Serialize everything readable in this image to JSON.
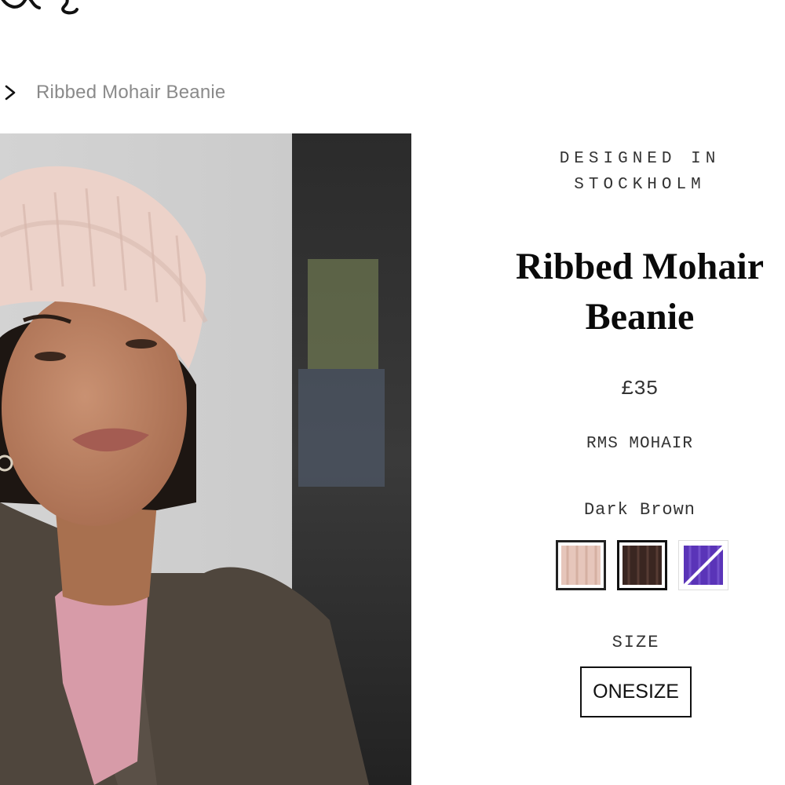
{
  "breadcrumb": {
    "current": "Ribbed Mohair Beanie"
  },
  "product": {
    "tagline_line1": "DESIGNED IN",
    "tagline_line2": "STOCKHOLM",
    "title_line1": "Ribbed Mohair",
    "title_line2": "Beanie",
    "price": "£35",
    "material": "RMS MOHAIR",
    "selected_color": "Dark Brown",
    "size_label": "SIZE",
    "size_option": "ONESIZE"
  },
  "swatches": [
    {
      "name": "light-pink",
      "color": "#e6c6bb",
      "state": "selected"
    },
    {
      "name": "dark-brown",
      "color": "#3a2621",
      "state": "normal"
    },
    {
      "name": "purple",
      "color": "#5a34b8",
      "state": "unavailable"
    }
  ],
  "icons": {
    "breadcrumb_separator": "chevron-right-icon",
    "logo": "brand-logo"
  }
}
